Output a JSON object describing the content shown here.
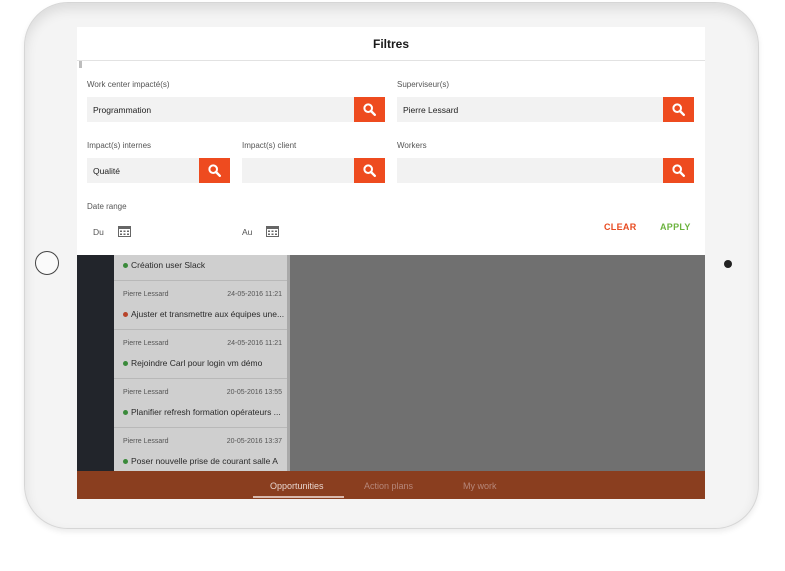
{
  "filter_panel": {
    "title": "Filtres",
    "work_center": {
      "label": "Work center impacté(s)",
      "value": "Programmation"
    },
    "superviseur": {
      "label": "Superviseur(s)",
      "value": "Pierre Lessard"
    },
    "impact_internes": {
      "label": "Impact(s) internes",
      "value": "Qualité"
    },
    "impact_client": {
      "label": "Impact(s) client",
      "value": ""
    },
    "workers": {
      "label": "Workers",
      "value": ""
    },
    "date_range": {
      "label": "Date range",
      "from_label": "Du",
      "to_label": "Au"
    },
    "clear_label": "CLEAR",
    "apply_label": "APPLY",
    "search_icon": "magnifier-icon",
    "calendar_icon": "calendar-icon",
    "accent_color": "#ee4b1f",
    "apply_color": "#6cb33f"
  },
  "background_list": {
    "items": [
      {
        "author": "",
        "date": "",
        "title": "Création user Slack",
        "status_color": "#3a8a3a"
      },
      {
        "author": "Pierre Lessard",
        "date": "24-05-2016 11:21",
        "title": "Ajuster et transmettre aux équipes une...",
        "status_color": "#b8442a"
      },
      {
        "author": "Pierre Lessard",
        "date": "24-05-2016 11:21",
        "title": "Rejoindre Carl pour login vm démo",
        "status_color": "#3a8a3a"
      },
      {
        "author": "Pierre Lessard",
        "date": "20-05-2016 13:55",
        "title": "Planifier refresh formation opérateurs ...",
        "status_color": "#3a8a3a"
      },
      {
        "author": "Pierre Lessard",
        "date": "20-05-2016 13:37",
        "title": "Poser nouvelle prise de courant salle A",
        "status_color": "#3a8a3a"
      }
    ]
  },
  "bottom_nav": {
    "tabs": [
      {
        "label": "Opportunities",
        "active": true
      },
      {
        "label": "Action plans",
        "active": false
      },
      {
        "label": "My work",
        "active": false
      }
    ]
  }
}
